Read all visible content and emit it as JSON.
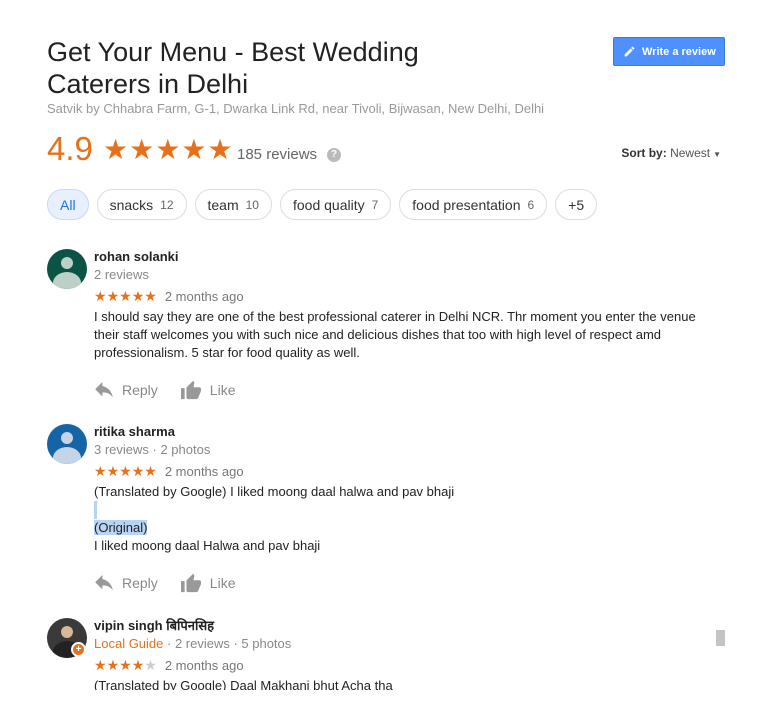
{
  "header": {
    "title": "Get Your Menu - Best Wedding Caterers in Delhi",
    "address": "Satvik by Chhabra Farm, G-1, Dwarka Link Rd, near Tivoli, Bijwasan, New Delhi, Delhi",
    "write_review_label": "Write a review"
  },
  "rating": {
    "score": "4.9",
    "stars": 5,
    "review_count": "185 reviews",
    "help_glyph": "?"
  },
  "sort": {
    "label": "Sort by:",
    "value": "Newest"
  },
  "chips": [
    {
      "label": "All",
      "count": ""
    },
    {
      "label": "snacks",
      "count": "12"
    },
    {
      "label": "team",
      "count": "10"
    },
    {
      "label": "food quality",
      "count": "7"
    },
    {
      "label": "food presentation",
      "count": "6"
    },
    {
      "label": "+5",
      "count": ""
    }
  ],
  "reviews": [
    {
      "name": "rohan solanki",
      "meta": "2 reviews",
      "stars": 5,
      "when": "2 months ago",
      "text": "I should say they are one of the best professional caterer in Delhi NCR. Thr moment you enter the venue their staff welcomes you with such nice and delicious dishes that too with high level of respect amd professionalism. 5 star for food quality as well.",
      "avatar_color": "#0b5345"
    },
    {
      "name": "ritika sharma",
      "meta": "3 reviews · 2 photos",
      "stars": 5,
      "when": "2 months ago",
      "translated": "(Translated by Google) I liked moong daal halwa and pav bhaji",
      "original_label": "(Original)",
      "original": "I liked moong daal Halwa and pav bhaji",
      "avatar_color": "#1565a6"
    },
    {
      "name": "vipin singh बिपिनसिह",
      "guide": "Local Guide",
      "meta": " · 2 reviews · 5 photos",
      "stars": 4,
      "when": "2 months ago",
      "text": "(Translated by Google) Daal Makhani bhut Acha tha"
    }
  ],
  "actions": {
    "reply": "Reply",
    "like": "Like"
  },
  "colors": {
    "accent": "#e7711b",
    "button": "#4d90fe",
    "chip_active": "#e8f0fe"
  }
}
